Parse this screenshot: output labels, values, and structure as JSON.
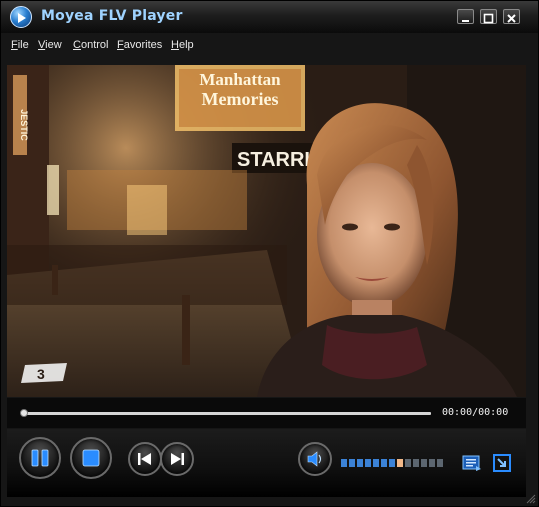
{
  "window": {
    "title": "Moyea FLV Player"
  },
  "menu": {
    "items": [
      "File",
      "View",
      "Control",
      "Favorites",
      "Help"
    ]
  },
  "video": {
    "marquee_line1": "Manhattan",
    "marquee_line2": "Memories",
    "sign_starring": "STARRING",
    "sign_vertical": "JESTIC",
    "watermark": "3"
  },
  "playback": {
    "time_display": "00:00/00:00",
    "progress": 0.0,
    "volume_level_fraction": 0.6,
    "volume_segments": 13,
    "volume_active_segment": 8
  },
  "colors": {
    "title_text": "#9fd3ff",
    "accent_blue": "#2a8cff",
    "volume_off": "#5c6670",
    "volume_on": "#3b82d6",
    "volume_current": "#f2b98a"
  }
}
